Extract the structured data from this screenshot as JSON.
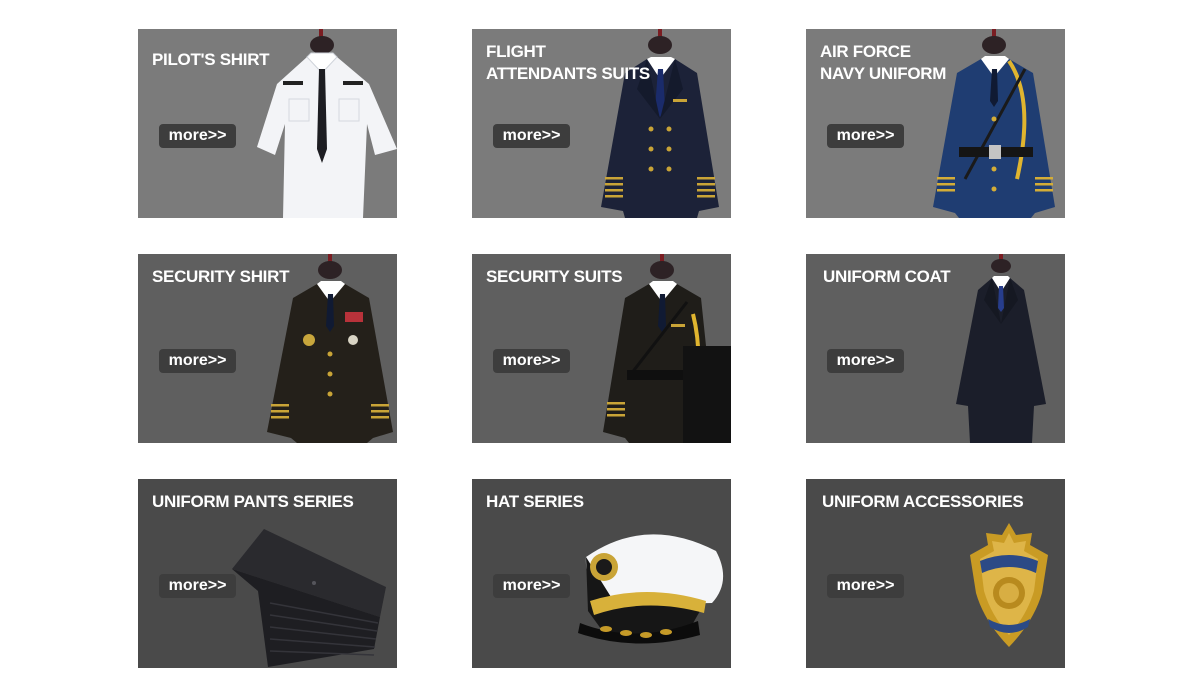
{
  "cards": [
    {
      "title": "PILOT'S SHIRT",
      "more": "more>>",
      "icon": "pilot-shirt-icon"
    },
    {
      "title": "FLIGHT\nATTENDANTS SUITS",
      "more": "more>>",
      "icon": "attendant-suit-icon"
    },
    {
      "title": "AIR FORCE\nNAVY UNIFORM",
      "more": "more>>",
      "icon": "navy-uniform-icon"
    },
    {
      "title": "SECURITY SHIRT",
      "more": "more>>",
      "icon": "security-shirt-icon"
    },
    {
      "title": "SECURITY SUITS",
      "more": "more>>",
      "icon": "security-suit-icon"
    },
    {
      "title": "UNIFORM COAT",
      "more": "more>>",
      "icon": "uniform-coat-icon"
    },
    {
      "title": "UNIFORM PANTS SERIES",
      "more": "more>>",
      "icon": "uniform-pants-icon"
    },
    {
      "title": "HAT SERIES",
      "more": "more>>",
      "icon": "peaked-cap-icon"
    },
    {
      "title": "UNIFORM ACCESSORIES",
      "more": "more>>",
      "icon": "police-badge-icon"
    }
  ],
  "colors": {
    "row1_bg": "#7b7b7b",
    "row2_bg": "#5f5f5f",
    "row3_bg": "#4a4a4a",
    "button_bg": "#3d3d3d"
  }
}
